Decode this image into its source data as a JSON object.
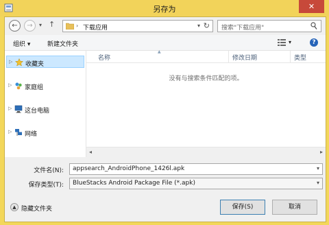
{
  "window": {
    "title": "另存为",
    "close_glyph": "✕"
  },
  "nav": {
    "back": "←",
    "forward": "→",
    "dropdown": "▾",
    "up": "↑"
  },
  "address": {
    "separator": "›",
    "crumb": "下载应用",
    "dropdown": "▾",
    "refresh": "↻"
  },
  "search": {
    "placeholder": "搜索\"下载应用\""
  },
  "toolbar": {
    "organize": "组织 ▾",
    "new_folder": "新建文件夹",
    "view_dd": "▾",
    "help": "?"
  },
  "sidebar": {
    "items": [
      {
        "label": "收藏夹",
        "icon": "star-icon"
      },
      {
        "label": "家庭组",
        "icon": "homegroup-icon"
      },
      {
        "label": "这台电脑",
        "icon": "computer-icon"
      },
      {
        "label": "网络",
        "icon": "network-icon"
      }
    ]
  },
  "columns": {
    "name": "名称",
    "modified": "修改日期",
    "type": "类型"
  },
  "content": {
    "empty_message": "没有与搜索条件匹配的项。"
  },
  "scroll": {
    "left": "◂",
    "right": "▸"
  },
  "form": {
    "filename_label": "文件名(N):",
    "filename_value": "appsearch_AndroidPhone_1426l.apk",
    "type_label": "保存类型(T):",
    "type_value": "BlueStacks Android Package File (*.apk)",
    "dropdown": "▾"
  },
  "footer": {
    "hide_folders": "隐藏文件夹",
    "save": "保存(S)",
    "cancel": "取消"
  },
  "colors": {
    "title_bar": "#f2d35a",
    "close": "#c7493a",
    "selection": "#cce8ff",
    "accent": "#2563b8"
  }
}
